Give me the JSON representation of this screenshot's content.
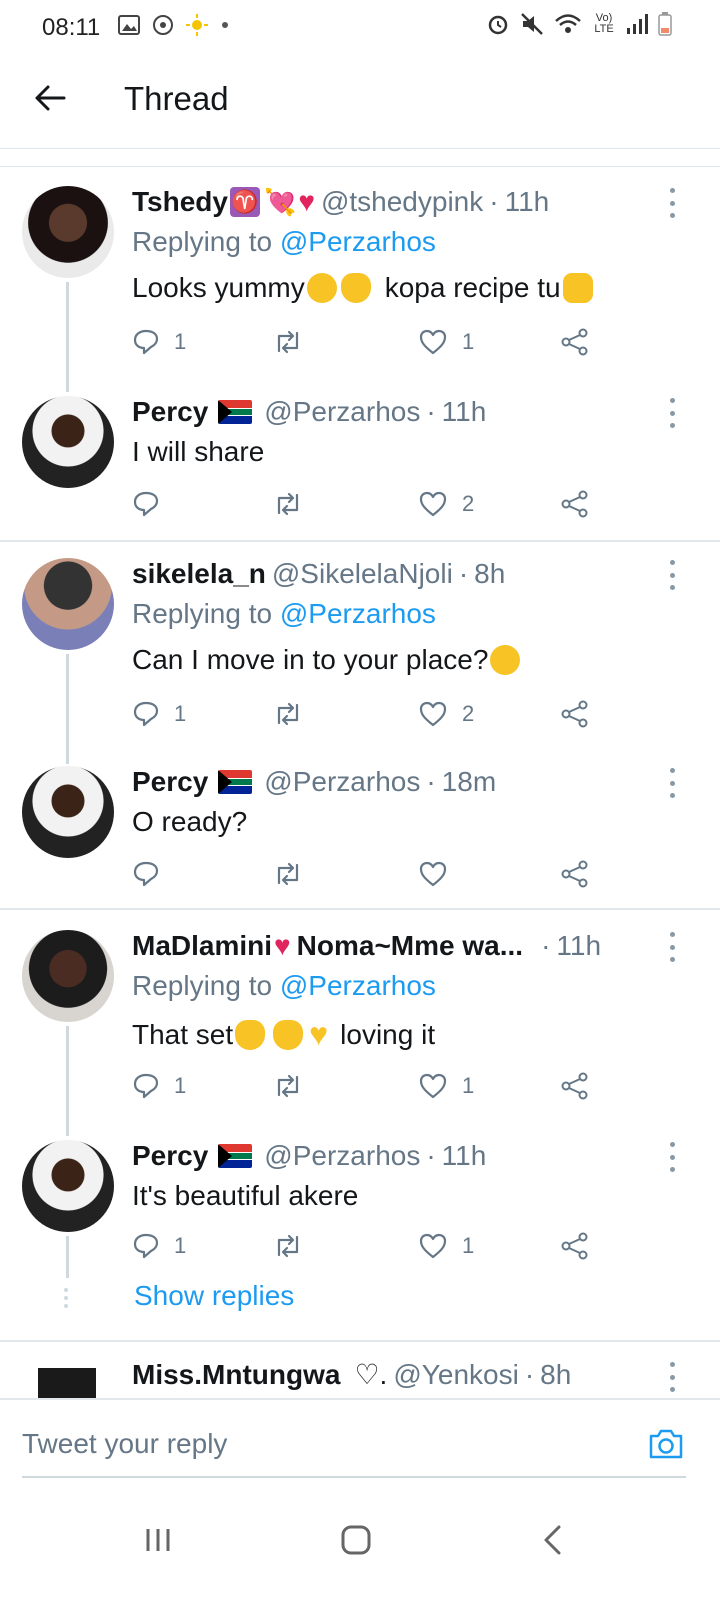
{
  "status_bar": {
    "time": "08:11",
    "network_label": "Vo) LTE"
  },
  "header": {
    "title": "Thread",
    "back_icon": "arrow-left-icon"
  },
  "tweets": [
    {
      "name": "Tshedy",
      "handle": "@tshedypink",
      "time": "11h",
      "replying_prefix": "Replying to",
      "replying_to": "@Perzarhos",
      "text_a": "Looks yummy",
      "text_b": "kopa recipe tu",
      "reply_count": "1",
      "retweet_count": "",
      "like_count": "1"
    },
    {
      "name": "Percy",
      "handle": "@Perzarhos",
      "time": "11h",
      "text_a": "I will share",
      "reply_count": "",
      "retweet_count": "",
      "like_count": "2"
    },
    {
      "name": "sikelela_n",
      "handle": "@SikelelaNjoli",
      "time": "8h",
      "replying_prefix": "Replying to",
      "replying_to": "@Perzarhos",
      "text_a": "Can I move in to your place?",
      "reply_count": "1",
      "retweet_count": "",
      "like_count": "2"
    },
    {
      "name": "Percy",
      "handle": "@Perzarhos",
      "time": "18m",
      "text_a": "O ready?",
      "reply_count": "",
      "retweet_count": "",
      "like_count": ""
    },
    {
      "name": "MaDlamini",
      "name_b": "Noma~Mme wa...",
      "time": "11h",
      "replying_prefix": "Replying to",
      "replying_to": "@Perzarhos",
      "text_a": "That set",
      "text_b": "loving it",
      "reply_count": "1",
      "retweet_count": "",
      "like_count": "1"
    },
    {
      "name": "Percy",
      "handle": "@Perzarhos",
      "time": "11h",
      "text_a": "It's beautiful akere",
      "reply_count": "1",
      "retweet_count": "",
      "like_count": "1"
    },
    {
      "name": "Miss.Mntungwa",
      "name_suffix": "♡.",
      "handle": "@Yenkosi",
      "time": "8h"
    }
  ],
  "show_replies": "Show replies",
  "separator": "·",
  "compose": {
    "placeholder": "Tweet your reply"
  },
  "colors": {
    "accent": "#1d9bf0",
    "text": "#14171a",
    "muted": "#657786",
    "heart": "#e0245e"
  }
}
